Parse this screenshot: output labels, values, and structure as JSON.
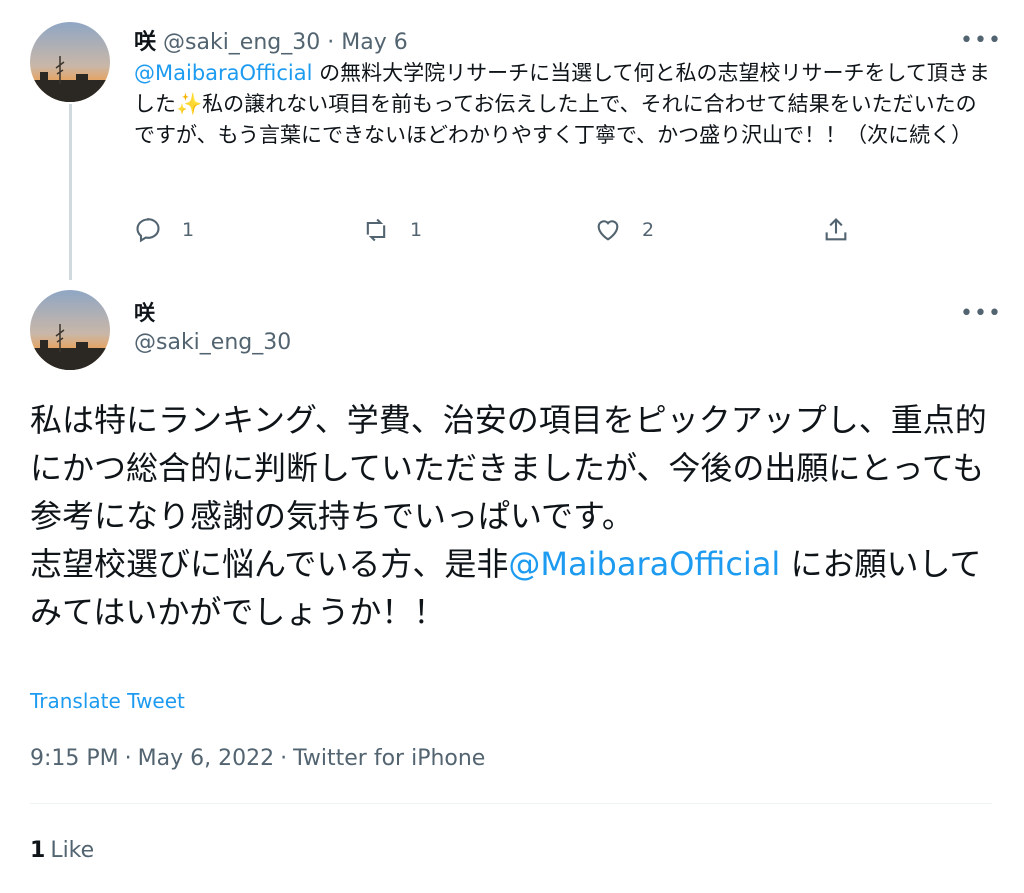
{
  "tweet1": {
    "name": "咲",
    "handle": "@saki_eng_30",
    "date": "May 6",
    "mention": "@MaibaraOfficial",
    "body_rest": " の無料大学院リサーチに当選して何と私の志望校リサーチをして頂きました✨私の譲れない項目を前もってお伝えした上で、それに合わせて結果をいただいたのですが、もう言葉にできないほどわかりやすく丁寧で、かつ盛り沢山で！！（次に続く）",
    "reply_count": "1",
    "retweet_count": "1",
    "like_count": "2"
  },
  "tweet2": {
    "name": "咲",
    "handle": "@saki_eng_30",
    "body_part1": "私は特にランキング、学費、治安の項目をピックアップし、重点的にかつ総合的に判断していただきましたが、今後の出願にとっても参考になり感謝の気持ちでいっぱいです。",
    "body_part2": "志望校選びに悩んでいる方、是非",
    "mention": "@MaibaraOfficial",
    "body_part3": " にお願いしてみてはいかがでしょうか！！",
    "translate_label": "Translate Tweet",
    "time": "9:15 PM",
    "full_date": "May 6, 2022",
    "source": "Twitter for iPhone",
    "likes_count": "1",
    "likes_label": "Like"
  },
  "icons": {
    "more": "more-icon",
    "reply": "reply-icon",
    "retweet": "retweet-icon",
    "like": "heart-icon",
    "share": "share-icon"
  }
}
